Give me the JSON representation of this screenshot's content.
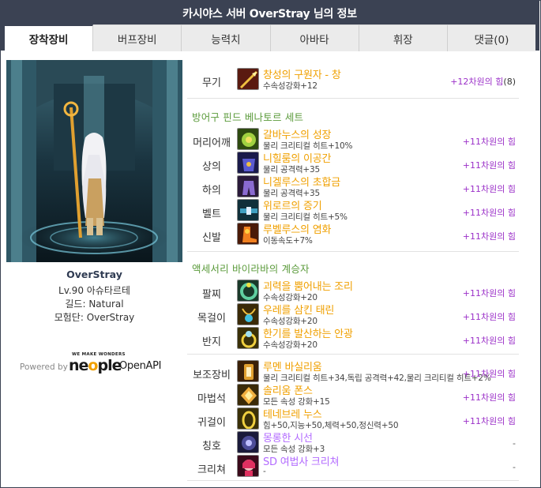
{
  "header": {
    "title": "카시야스 서버 OverStray 님의 정보"
  },
  "tabs": [
    {
      "label": "장착장비",
      "active": true
    },
    {
      "label": "버프장비"
    },
    {
      "label": "능력치"
    },
    {
      "label": "아바타"
    },
    {
      "label": "휘장"
    },
    {
      "label": "댓글(0)"
    }
  ],
  "character": {
    "name": "OverStray",
    "level_job": "Lv.90 아슈타르테",
    "guild": "길드: Natural",
    "adventure": "모험단: OverStray"
  },
  "powered": {
    "powered_by": "Powered by",
    "tagline": "WE MAKE WONDERS",
    "brand_pre": "ne",
    "brand_o": "o",
    "brand_post": "ple",
    "api": "OpenAPI"
  },
  "sections": {
    "armor_set": "방어구   핀드 베나토르 세트",
    "accessory_set": "액세서리  바이라바의 계승자"
  },
  "equipment": {
    "weapon": {
      "slot": "무기",
      "name": "창성의 구원자 - 창",
      "sub": "수속성강화+12",
      "amp": "+12차원의 힘",
      "count": "(8)",
      "icon": "spear-icon"
    },
    "head": {
      "slot": "머리어깨",
      "name": "갈바누스의 성장",
      "sub": "물리 크리티컬 히트+10%",
      "amp": "+11차원의 힘",
      "icon": "shoulder-armor-icon"
    },
    "top": {
      "slot": "상의",
      "name": "니힐룸의 이공간",
      "sub": "물리 공격력+35",
      "amp": "+11차원의 힘",
      "icon": "top-armor-icon"
    },
    "bottom": {
      "slot": "하의",
      "name": "니겔루스의 초합금",
      "sub": "물리 공격력+35",
      "amp": "+11차원의 힘",
      "icon": "bottom-armor-icon"
    },
    "belt": {
      "slot": "벨트",
      "name": "위로르의 증기",
      "sub": "물리 크리티컬 히트+5%",
      "amp": "+11차원의 힘",
      "icon": "belt-icon"
    },
    "shoes": {
      "slot": "신발",
      "name": "루벨루스의 염화",
      "sub": "이동속도+7%",
      "amp": "+11차원의 힘",
      "icon": "shoes-icon"
    },
    "bracelet": {
      "slot": "팔찌",
      "name": "괴력을 뿜어내는 조리",
      "sub": "수속성강화+20",
      "amp": "+11차원의 힘",
      "icon": "bracelet-icon"
    },
    "necklace": {
      "slot": "목걸이",
      "name": "우레를 삼킨 태린",
      "sub": "수속성강화+20",
      "amp": "+11차원의 힘",
      "icon": "necklace-icon"
    },
    "ring": {
      "slot": "반지",
      "name": "한기를 발산하는 안광",
      "sub": "수속성강화+20",
      "amp": "+11차원의 힘",
      "icon": "ring-icon"
    },
    "support": {
      "slot": "보조장비",
      "name": "루멘 바실리움",
      "sub": "물리 크리티컬 히트+34,독립 공격력+42,물리 크리티컬 히트+2%",
      "amp": "+11차원의 힘",
      "icon": "support-equip-icon"
    },
    "magicstone": {
      "slot": "마법석",
      "name": "솔리움 폰스",
      "sub": "모든 속성 강화+15",
      "amp": "+11차원의 힘",
      "icon": "magic-stone-icon"
    },
    "earring": {
      "slot": "귀걸이",
      "name": "테네브레 누스",
      "sub": "힘+50,지능+50,체력+50,정신력+50",
      "amp": "+11차원의 힘",
      "icon": "earring-icon"
    },
    "title": {
      "slot": "칭호",
      "name": "몽롱한 시선",
      "sub": "모든 속성 강화+3",
      "amp": "-",
      "icon": "title-icon"
    },
    "creature": {
      "slot": "크리쳐",
      "name": "SD 여법사 크리쳐",
      "sub": "-",
      "amp": "-",
      "icon": "creature-icon"
    }
  },
  "colors": {
    "header_bg": "#3b4253",
    "epic": "#f0a000",
    "rare": "#b36bff",
    "amp": "#9b30c8",
    "set_green": "#5a9a3a"
  }
}
